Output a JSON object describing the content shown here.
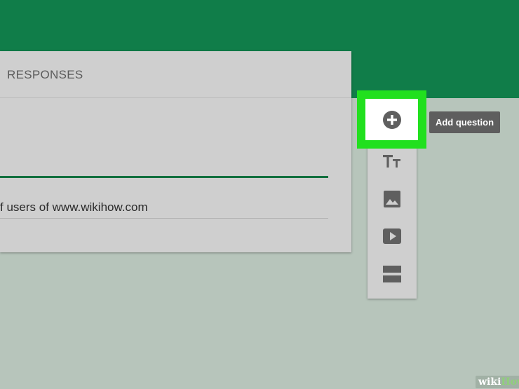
{
  "form": {
    "tabs": {
      "responses_label": "RESPONSES"
    },
    "description_text": "f users of www.wikihow.com"
  },
  "toolbar": {
    "add_question_icon": "add-circle-icon",
    "add_title_icon": "title-text-icon",
    "add_image_icon": "image-icon",
    "add_video_icon": "video-play-icon",
    "add_section_icon": "section-icon",
    "tooltip_label": "Add question"
  },
  "colors": {
    "header": "#107d49",
    "highlight": "#21e01e",
    "underline_active": "#12703f"
  },
  "watermark": {
    "part1": "wiki",
    "part2": "How"
  }
}
